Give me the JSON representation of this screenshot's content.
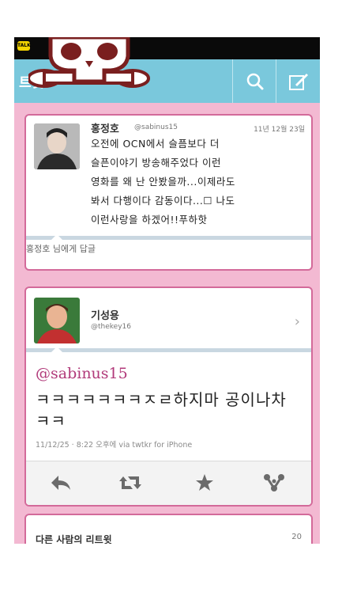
{
  "header": {
    "title": "트윗",
    "search_icon": "search-icon",
    "compose_icon": "compose-icon",
    "accent": "#7ac8dc",
    "background": "#f3b9d2"
  },
  "tweet": {
    "author_name": "홍정호",
    "author_handle": "@sabinus15",
    "date": "11년 12월 23일",
    "lines": [
      "오전에 OCN에서 슬픔보다 더",
      "슬픈이야기 방송해주었다 이런",
      "영화를 왜 난 안봤을까...이제라도",
      "봐서 다행이다 감동이다...☐ 나도",
      "이런사랑을 하겠어!!푸하핫"
    ],
    "reply_hint": "홍정호 님에게 답글"
  },
  "reply": {
    "author_name": "기성용",
    "author_handle": "@thekey16",
    "mention": "@sabinus15",
    "text": "ㅋㅋㅋㅋㅋㅋㅋㅈㄹ하지마 공이나차 ㅋㅋ",
    "meta": "11/12/25 · 8:22 오후에 via twtkr for iPhone"
  },
  "retweets": {
    "title": "다른 사람의 리트윗",
    "count": "20"
  }
}
